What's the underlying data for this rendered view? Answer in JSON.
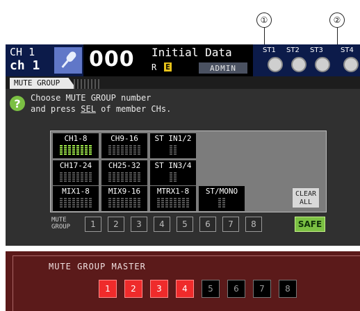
{
  "callouts": [
    "①",
    "②"
  ],
  "header": {
    "ch_num": "CH 1",
    "ch_name": "ch 1",
    "scene_number": "000",
    "scene_title": "Initial Data",
    "scene_flag_r": "R",
    "scene_flag_e": "E",
    "user_level": "ADMIN",
    "st_labels": [
      "ST1",
      "ST2",
      "ST3",
      "ST4"
    ]
  },
  "tab": {
    "label": "MUTE GROUP"
  },
  "instructions": {
    "line1": "Choose MUTE GROUP number",
    "line2_pre": "and press ",
    "line2_key": "SEL",
    "line2_post": " of member CHs."
  },
  "channel_groups": [
    {
      "label": "CH1-8",
      "active": true,
      "bars": 8
    },
    {
      "label": "CH9-16",
      "active": false,
      "bars": 8
    },
    {
      "label": "ST IN1/2",
      "active": false,
      "bars": 2
    },
    {
      "label": "CH17-24",
      "active": false,
      "bars": 8
    },
    {
      "label": "CH25-32",
      "active": false,
      "bars": 8
    },
    {
      "label": "ST IN3/4",
      "active": false,
      "bars": 2
    },
    {
      "label": "MIX1-8",
      "active": false,
      "bars": 8
    },
    {
      "label": "MIX9-16",
      "active": false,
      "bars": 8
    },
    {
      "label": "MTRX1-8",
      "active": false,
      "bars": 8
    },
    {
      "label": "ST/MONO",
      "active": false,
      "bars": 2
    }
  ],
  "clear_all": {
    "line1": "CLEAR",
    "line2": "ALL"
  },
  "mute_group_row": {
    "label_line1": "MUTE",
    "label_line2": "GROUP",
    "buttons": [
      "1",
      "2",
      "3",
      "4",
      "5",
      "6",
      "7",
      "8"
    ],
    "safe": "SAFE"
  },
  "master": {
    "title": "MUTE GROUP MASTER",
    "buttons": [
      "1",
      "2",
      "3",
      "4",
      "5",
      "6",
      "7",
      "8"
    ],
    "states": [
      true,
      true,
      true,
      true,
      false,
      false,
      false,
      false
    ]
  },
  "colors": {
    "header_bg": "#0c1b4a",
    "active_green": "#7bc043",
    "master_red": "#ef2b2b",
    "master_bg": "#5b1a1a"
  }
}
